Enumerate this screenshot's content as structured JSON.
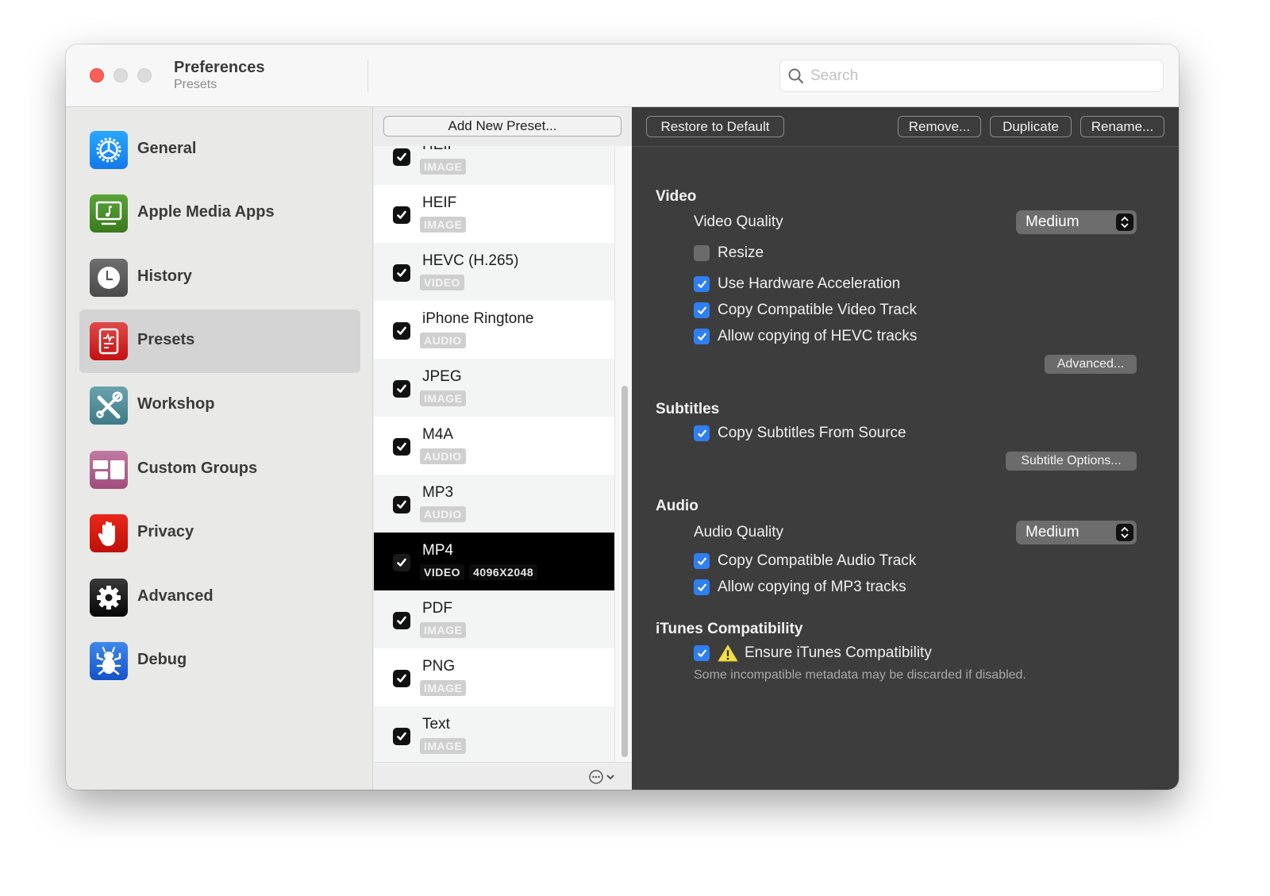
{
  "window": {
    "title": "Preferences",
    "subtitle": "Presets",
    "traffic_lights": [
      "close",
      "minimize",
      "zoom"
    ]
  },
  "search": {
    "placeholder": "Search",
    "value": ""
  },
  "sidebar": {
    "selected": "Presets",
    "items": [
      {
        "label": "General",
        "icon": "gear-wheel-icon",
        "color": "#1f8ff5"
      },
      {
        "label": "Apple Media Apps",
        "icon": "monitor-music-note-icon",
        "color": "#4a8a2a"
      },
      {
        "label": "History",
        "icon": "clock-icon",
        "color": "#5a5a5a"
      },
      {
        "label": "Presets",
        "icon": "document-waveform-icon",
        "color": "#d41e1e"
      },
      {
        "label": "Workshop",
        "icon": "tools-icon",
        "color": "#4b8797"
      },
      {
        "label": "Custom Groups",
        "icon": "grid-tiles-icon",
        "color": "#b35c8c"
      },
      {
        "label": "Privacy",
        "icon": "hand-stop-icon",
        "color": "#d81a10"
      },
      {
        "label": "Advanced",
        "icon": "gear-icon",
        "color": "#111111"
      },
      {
        "label": "Debug",
        "icon": "bug-icon",
        "color": "#1e62d6"
      }
    ]
  },
  "presets": {
    "add_button": "Add New Preset...",
    "items": [
      {
        "name": "HEIF",
        "tags": [
          "IMAGE"
        ],
        "checked": true,
        "partial": true
      },
      {
        "name": "HEIF",
        "tags": [
          "IMAGE"
        ],
        "checked": true
      },
      {
        "name": "HEVC (H.265)",
        "tags": [
          "VIDEO"
        ],
        "checked": true
      },
      {
        "name": "iPhone Ringtone",
        "tags": [
          "AUDIO"
        ],
        "checked": true
      },
      {
        "name": "JPEG",
        "tags": [
          "IMAGE"
        ],
        "checked": true
      },
      {
        "name": "M4A",
        "tags": [
          "AUDIO"
        ],
        "checked": true
      },
      {
        "name": "MP3",
        "tags": [
          "AUDIO"
        ],
        "checked": true
      },
      {
        "name": "MP4",
        "tags": [
          "VIDEO",
          "4096X2048"
        ],
        "checked": true,
        "selected": true
      },
      {
        "name": "PDF",
        "tags": [
          "IMAGE"
        ],
        "checked": true
      },
      {
        "name": "PNG",
        "tags": [
          "IMAGE"
        ],
        "checked": true
      },
      {
        "name": "Text",
        "tags": [
          "IMAGE"
        ],
        "checked": true
      }
    ],
    "footer_menu_icon": "ellipsis-circle-icon"
  },
  "detail": {
    "toolbar": {
      "restore": "Restore to Default",
      "remove": "Remove...",
      "duplicate": "Duplicate",
      "rename": "Rename..."
    },
    "video": {
      "heading": "Video",
      "quality_label": "Video Quality",
      "quality_value": "Medium",
      "resize": {
        "label": "Resize",
        "checked": false
      },
      "hw_accel": {
        "label": "Use Hardware Acceleration",
        "checked": true
      },
      "copy_video": {
        "label": "Copy Compatible Video Track",
        "checked": true
      },
      "copy_hevc": {
        "label": "Allow copying of HEVC tracks",
        "checked": true
      },
      "advanced_button": "Advanced..."
    },
    "subtitles": {
      "heading": "Subtitles",
      "copy_subs": {
        "label": "Copy Subtitles From Source",
        "checked": true
      },
      "options_button": "Subtitle Options..."
    },
    "audio": {
      "heading": "Audio",
      "quality_label": "Audio Quality",
      "quality_value": "Medium",
      "copy_audio": {
        "label": "Copy Compatible Audio Track",
        "checked": true
      },
      "copy_mp3": {
        "label": "Allow copying of MP3 tracks",
        "checked": true
      }
    },
    "itunes": {
      "heading": "iTunes Compatibility",
      "ensure": {
        "label": "Ensure iTunes Compatibility",
        "checked": true
      },
      "hint": "Some incompatible metadata may be discarded if disabled."
    }
  }
}
